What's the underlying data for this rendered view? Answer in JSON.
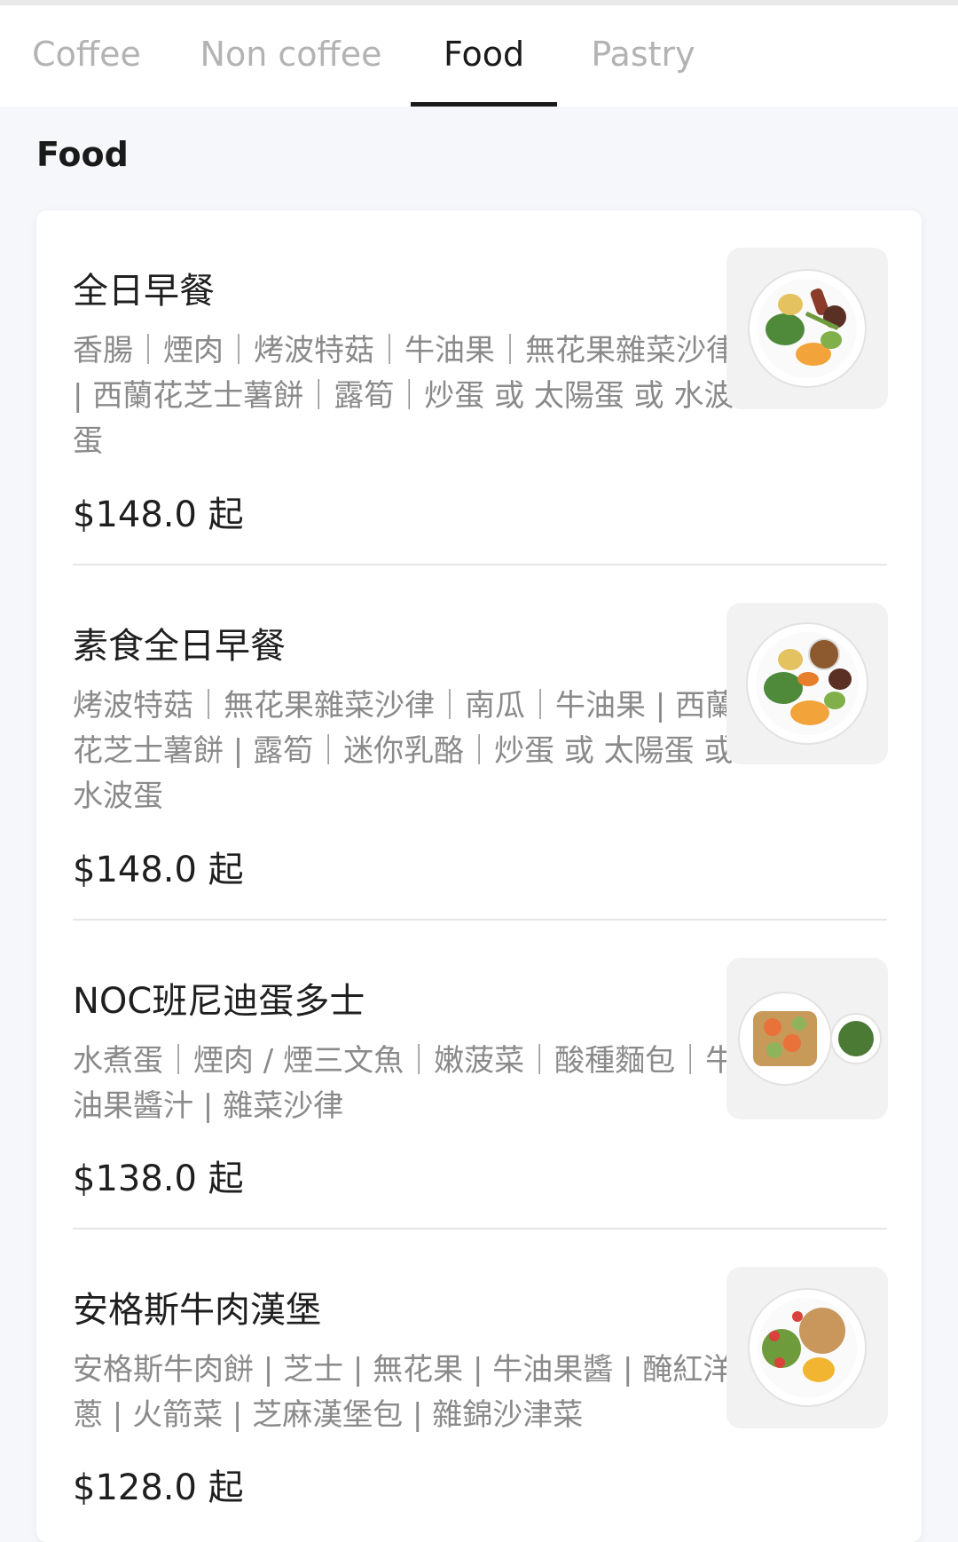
{
  "tabs": [
    {
      "label": "Coffee",
      "active": false
    },
    {
      "label": "Non coffee",
      "active": false
    },
    {
      "label": "Food",
      "active": true
    },
    {
      "label": "Pastry",
      "active": false
    }
  ],
  "section": {
    "title": "Food"
  },
  "items": [
    {
      "name": "全日早餐",
      "desc": "香腸｜煙肉｜烤波特菇｜牛油果｜無花果雜菜沙律 | 西蘭花芝士薯餅｜露筍｜炒蛋 或 太陽蛋 或 水波蛋",
      "price": "$148.0 起",
      "image": "breakfast-plate-image"
    },
    {
      "name": "素食全日早餐",
      "desc": "烤波特菇｜無花果雜菜沙律｜南瓜｜牛油果 | 西蘭花芝士薯餅 | 露筍｜迷你乳酪｜炒蛋 或 太陽蛋 或 水波蛋",
      "price": "$148.0 起",
      "image": "vegetarian-breakfast-plate-image"
    },
    {
      "name": "NOC班尼迪蛋多士",
      "desc": "水煮蛋｜煙肉 / 煙三文魚｜嫩菠菜｜酸種麵包｜牛油果醬汁 | 雜菜沙律",
      "price": "$138.0 起",
      "image": "eggs-benedict-toast-image"
    },
    {
      "name": "安格斯牛肉漢堡",
      "desc": "安格斯牛肉餅 | 芝士 | 無花果 | 牛油果醬 | 醃紅洋蔥 | 火箭菜 | 芝麻漢堡包 | 雜錦沙津菜",
      "price": "$128.0 起",
      "image": "angus-burger-plate-image"
    }
  ],
  "colors": {
    "active_tab": "#1a1a1a",
    "inactive_tab": "#b3b3b3",
    "desc_text": "#8a8a8a",
    "page_bg": "#f5f7fa"
  }
}
